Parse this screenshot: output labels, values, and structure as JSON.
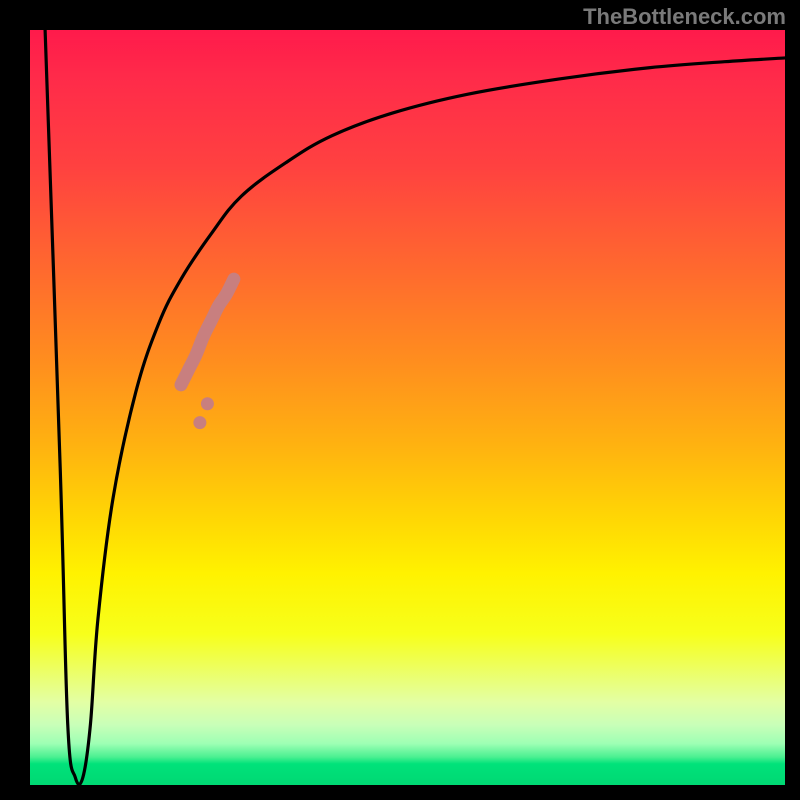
{
  "watermark": "TheBottleneck.com",
  "chart_data": {
    "type": "line",
    "title": "",
    "xlabel": "",
    "ylabel": "",
    "xlim": [
      0,
      100
    ],
    "ylim": [
      0,
      100
    ],
    "gradient_stops": [
      {
        "pct": 0,
        "color": "#ff1a4b"
      },
      {
        "pct": 18,
        "color": "#ff4140"
      },
      {
        "pct": 44,
        "color": "#ff8e1e"
      },
      {
        "pct": 64,
        "color": "#ffd405"
      },
      {
        "pct": 80,
        "color": "#f7ff1b"
      },
      {
        "pct": 92,
        "color": "#c9ffb8"
      },
      {
        "pct": 96,
        "color": "#4af091"
      },
      {
        "pct": 100,
        "color": "#00d873"
      }
    ],
    "series": [
      {
        "name": "main-curve",
        "x": [
          2,
          4,
          5,
          6,
          7,
          8,
          9,
          11,
          14,
          17,
          20,
          24,
          28,
          34,
          40,
          48,
          58,
          70,
          82,
          92,
          100
        ],
        "y": [
          100,
          42,
          8,
          1,
          1,
          8,
          22,
          38,
          52,
          61,
          67,
          73,
          78,
          82.5,
          86,
          89,
          91.5,
          93.5,
          95,
          95.8,
          96.3
        ]
      }
    ],
    "highlight_segment": {
      "series": "main-curve",
      "description": "thick salmon segment on ascending branch",
      "x": [
        20,
        21,
        22,
        23,
        24,
        25,
        26,
        27
      ],
      "y": [
        53,
        55,
        57,
        59.5,
        61.5,
        63.5,
        65,
        67
      ],
      "color": "#c87f7f"
    },
    "highlight_dots": {
      "x": [
        22.5,
        23.5
      ],
      "y": [
        48,
        50.5
      ],
      "color": "#c87f7f"
    }
  }
}
